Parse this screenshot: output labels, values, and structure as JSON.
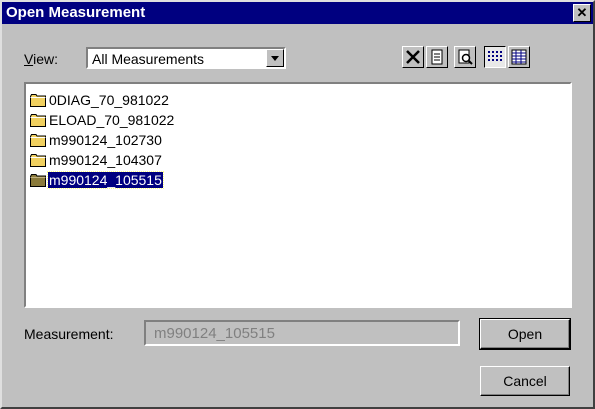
{
  "window": {
    "title": "Open Measurement",
    "close_glyph": "✕"
  },
  "view": {
    "label_accel": "V",
    "label_rest": "iew:",
    "selected": "All Measurements"
  },
  "toolbar": {
    "icons": [
      "delete-icon",
      "properties-icon",
      "preview-icon",
      "list-view-icon",
      "details-view-icon"
    ]
  },
  "list": {
    "items": [
      {
        "label": "0DIAG_70_981022",
        "selected": false
      },
      {
        "label": "ELOAD_70_981022",
        "selected": false
      },
      {
        "label": "m990124_102730",
        "selected": false
      },
      {
        "label": "m990124_104307",
        "selected": false
      },
      {
        "label": "m990124_105515",
        "selected": true
      }
    ]
  },
  "measurement": {
    "label": "Measurement:",
    "value": "m990124_105515"
  },
  "buttons": {
    "open": "Open",
    "cancel": "Cancel"
  },
  "colors": {
    "title_bar": "#000080",
    "face": "#c0c0c0",
    "selection": "#000080",
    "folder": "#f0d060"
  }
}
